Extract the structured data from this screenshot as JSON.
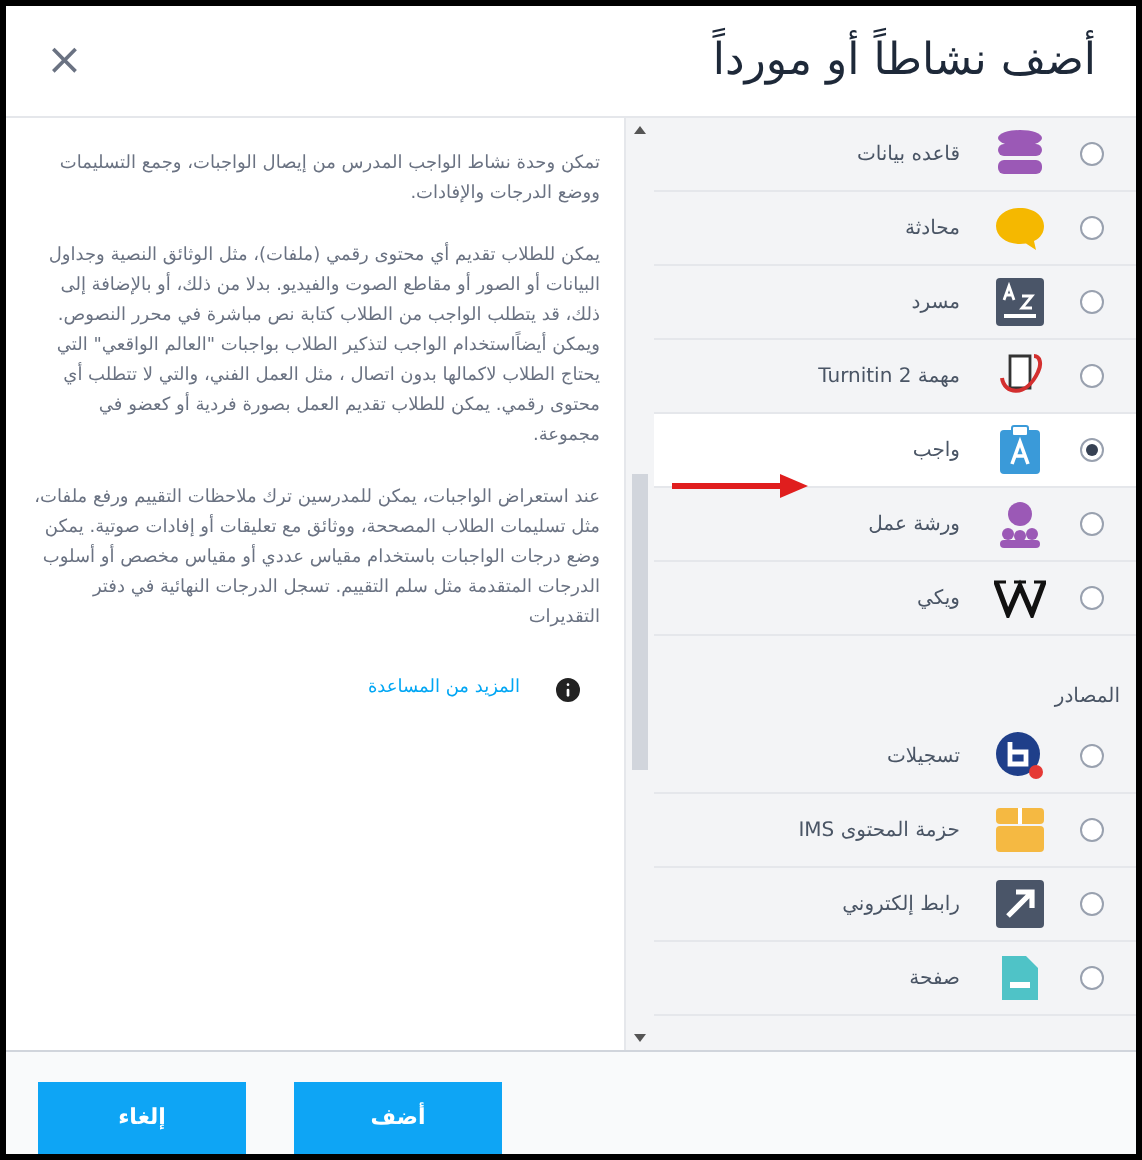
{
  "dialog": {
    "title": "أضف نشاطاً أو مورداً",
    "close": "×"
  },
  "description": {
    "paragraphs": [
      "تمكن وحدة نشاط الواجب المدرس من إيصال الواجبات، وجمع التسليمات ووضع الدرجات والإفادات.",
      "يمكن للطلاب تقديم أي محتوى رقمي (ملفات)، مثل الوثائق النصية وجداول البيانات أو الصور أو مقاطع الصوت والفيديو. بدلا من ذلك، أو بالإضافة إلى ذلك، قد يتطلب الواجب من الطلاب كتابة نص مباشرة في محرر النصوص. ويمكن أيضاًاستخدام الواجب لتذكير الطلاب بواجبات \"العالم الواقعي\" التي يحتاج الطلاب لاكمالها بدون اتصال ، مثل العمل الفني، والتي لا تتطلب أي محتوى رقمي. يمكن للطلاب تقديم العمل بصورة فردية أو كعضو في مجموعة.",
      "عند استعراض الواجبات، يمكن للمدرسين ترك ملاحظات التقييم ورفع ملفات، مثل تسليمات الطلاب المصححة، ووثائق مع تعليقات أو إفادات صوتية. يمكن وضع درجات الواجبات باستخدام مقياس عددي أو مقياس مخصص أو أسلوب الدرجات المتقدمة مثل سلم التقييم. تسجل الدرجات النهائية في دفتر التقديرات"
    ],
    "help_link": "المزيد من المساعدة"
  },
  "items": [
    {
      "kind": "option",
      "label": "قاعده بيانات",
      "selected": false
    },
    {
      "kind": "option",
      "label": "محادثة",
      "selected": false
    },
    {
      "kind": "option",
      "label": "مسرد",
      "selected": false
    },
    {
      "kind": "option",
      "label": "مهمة Turnitin 2",
      "selected": false
    },
    {
      "kind": "option",
      "label": "واجب",
      "selected": true
    },
    {
      "kind": "option",
      "label": "ورشة عمل",
      "selected": false
    },
    {
      "kind": "option",
      "label": "ويكي",
      "selected": false
    },
    {
      "kind": "heading",
      "label": "المصادر"
    },
    {
      "kind": "option",
      "label": "تسجيلات",
      "selected": false
    },
    {
      "kind": "option",
      "label": "حزمة المحتوى IMS",
      "selected": false
    },
    {
      "kind": "option",
      "label": "رابط إلكتروني",
      "selected": false
    },
    {
      "kind": "option",
      "label": "صفحة",
      "selected": false
    }
  ],
  "buttons": [
    {
      "label": "أضف"
    },
    {
      "label": "إلغاء"
    }
  ]
}
